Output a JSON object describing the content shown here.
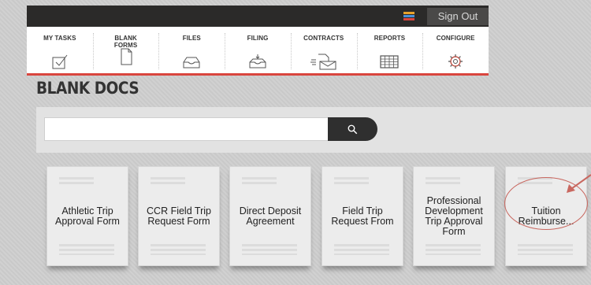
{
  "header": {
    "signout_label": "Sign Out",
    "menu_colors": [
      "#e8a22c",
      "#4a90d9",
      "#d9453e"
    ]
  },
  "nav": {
    "items": [
      {
        "label": "MY TASKS",
        "icon": "checkbox-icon"
      },
      {
        "label": "BLANK FORMS",
        "icon": "document-icon"
      },
      {
        "label": "FILES",
        "icon": "tray-icon"
      },
      {
        "label": "FILING",
        "icon": "inbox-icon"
      },
      {
        "label": "CONTRACTS",
        "icon": "mail-document-icon"
      },
      {
        "label": "REPORTS",
        "icon": "spreadsheet-icon"
      },
      {
        "label": "CONFIGURE",
        "icon": "gear-icon"
      }
    ],
    "accent_color": "#d9453e"
  },
  "page": {
    "title": "BLANK DOCS"
  },
  "search": {
    "value": "",
    "placeholder": ""
  },
  "forms": [
    {
      "title": "Athletic Trip Approval Form"
    },
    {
      "title": "CCR Field Trip Request Form"
    },
    {
      "title": "Direct Deposit Agreement"
    },
    {
      "title": "Field Trip Request From"
    },
    {
      "title": "Professional Development Trip Approval Form"
    },
    {
      "title": "Tuition Reimburse..."
    }
  ],
  "annotation": {
    "color": "#c96860",
    "highlighted_item": "Tuition Reimburse..."
  }
}
